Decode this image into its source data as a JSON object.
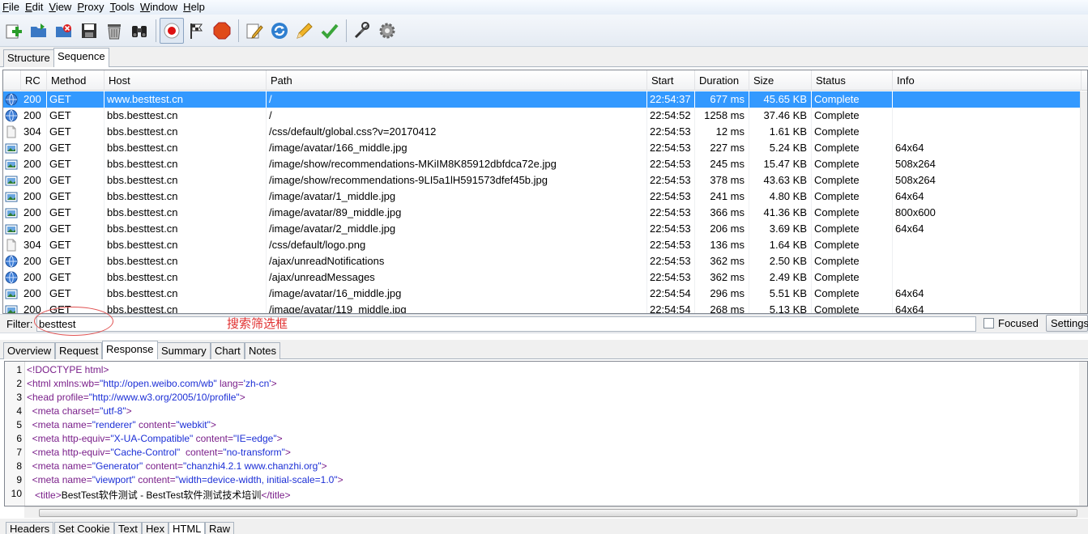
{
  "menu": {
    "items": [
      {
        "label": "File",
        "mnemonic": "F"
      },
      {
        "label": "Edit",
        "mnemonic": "E"
      },
      {
        "label": "View",
        "mnemonic": "V"
      },
      {
        "label": "Proxy",
        "mnemonic": "P"
      },
      {
        "label": "Tools",
        "mnemonic": "T"
      },
      {
        "label": "Window",
        "mnemonic": "W"
      },
      {
        "label": "Help",
        "mnemonic": "H"
      }
    ]
  },
  "toolbar": {
    "buttons": [
      "add-icon",
      "open-icon",
      "close-icon",
      "save-icon",
      "trash-icon",
      "find-binoculars-icon",
      "record-icon",
      "flag-icon",
      "stop-icon",
      "edit-icon",
      "refresh-icon",
      "pencil-icon",
      "checkmark-icon",
      "tools-icon",
      "settings-gear-icon"
    ]
  },
  "view_tabs": {
    "structure": "Structure",
    "sequence": "Sequence",
    "active": "Sequence"
  },
  "table": {
    "columns": {
      "rc": "RC",
      "method": "Method",
      "host": "Host",
      "path": "Path",
      "start": "Start",
      "duration": "Duration",
      "size": "Size",
      "status": "Status",
      "info": "Info"
    },
    "selected_index": 0,
    "rows": [
      {
        "icon": "globe",
        "rc": "200",
        "method": "GET",
        "host": "www.besttest.cn",
        "path": "/",
        "start": "22:54:37",
        "duration": "677 ms",
        "size": "45.65 KB",
        "status": "Complete",
        "info": ""
      },
      {
        "icon": "globe",
        "rc": "200",
        "method": "GET",
        "host": "bbs.besttest.cn",
        "path": "/",
        "start": "22:54:52",
        "duration": "1258 ms",
        "size": "37.46 KB",
        "status": "Complete",
        "info": ""
      },
      {
        "icon": "doc",
        "rc": "304",
        "method": "GET",
        "host": "bbs.besttest.cn",
        "path": "/css/default/global.css?v=20170412",
        "start": "22:54:53",
        "duration": "12 ms",
        "size": "1.61 KB",
        "status": "Complete",
        "info": ""
      },
      {
        "icon": "image",
        "rc": "200",
        "method": "GET",
        "host": "bbs.besttest.cn",
        "path": "/image/avatar/166_middle.jpg",
        "start": "22:54:53",
        "duration": "227 ms",
        "size": "5.24 KB",
        "status": "Complete",
        "info": "64x64"
      },
      {
        "icon": "image",
        "rc": "200",
        "method": "GET",
        "host": "bbs.besttest.cn",
        "path": "/image/show/recommendations-MKiIM8K85912dbfdca72e.jpg",
        "start": "22:54:53",
        "duration": "245 ms",
        "size": "15.47 KB",
        "status": "Complete",
        "info": "508x264"
      },
      {
        "icon": "image",
        "rc": "200",
        "method": "GET",
        "host": "bbs.besttest.cn",
        "path": "/image/show/recommendations-9LI5a1lH591573dfef45b.jpg",
        "start": "22:54:53",
        "duration": "378 ms",
        "size": "43.63 KB",
        "status": "Complete",
        "info": "508x264"
      },
      {
        "icon": "image",
        "rc": "200",
        "method": "GET",
        "host": "bbs.besttest.cn",
        "path": "/image/avatar/1_middle.jpg",
        "start": "22:54:53",
        "duration": "241 ms",
        "size": "4.80 KB",
        "status": "Complete",
        "info": "64x64"
      },
      {
        "icon": "image",
        "rc": "200",
        "method": "GET",
        "host": "bbs.besttest.cn",
        "path": "/image/avatar/89_middle.jpg",
        "start": "22:54:53",
        "duration": "366 ms",
        "size": "41.36 KB",
        "status": "Complete",
        "info": "800x600"
      },
      {
        "icon": "image",
        "rc": "200",
        "method": "GET",
        "host": "bbs.besttest.cn",
        "path": "/image/avatar/2_middle.jpg",
        "start": "22:54:53",
        "duration": "206 ms",
        "size": "3.69 KB",
        "status": "Complete",
        "info": "64x64"
      },
      {
        "icon": "doc",
        "rc": "304",
        "method": "GET",
        "host": "bbs.besttest.cn",
        "path": "/css/default/logo.png",
        "start": "22:54:53",
        "duration": "136 ms",
        "size": "1.64 KB",
        "status": "Complete",
        "info": ""
      },
      {
        "icon": "globe",
        "rc": "200",
        "method": "GET",
        "host": "bbs.besttest.cn",
        "path": "/ajax/unreadNotifications",
        "start": "22:54:53",
        "duration": "362 ms",
        "size": "2.50 KB",
        "status": "Complete",
        "info": ""
      },
      {
        "icon": "globe",
        "rc": "200",
        "method": "GET",
        "host": "bbs.besttest.cn",
        "path": "/ajax/unreadMessages",
        "start": "22:54:53",
        "duration": "362 ms",
        "size": "2.49 KB",
        "status": "Complete",
        "info": ""
      },
      {
        "icon": "image",
        "rc": "200",
        "method": "GET",
        "host": "bbs.besttest.cn",
        "path": "/image/avatar/16_middle.jpg",
        "start": "22:54:54",
        "duration": "296 ms",
        "size": "5.51 KB",
        "status": "Complete",
        "info": "64x64"
      },
      {
        "icon": "image",
        "rc": "200",
        "method": "GET",
        "host": "bbs.besttest.cn",
        "path": "/image/avatar/119_middle.jpg",
        "start": "22:54:54",
        "duration": "268 ms",
        "size": "5.13 KB",
        "status": "Complete",
        "info": "64x64"
      }
    ]
  },
  "filter": {
    "label": "Filter:",
    "value": "besttest",
    "annotation": "搜索筛选框",
    "focused_label": "Focused",
    "focused_checked": false,
    "settings_label": "Settings"
  },
  "detail_tabs": {
    "items": [
      "Overview",
      "Request",
      "Response",
      "Summary",
      "Chart",
      "Notes"
    ],
    "active": "Response"
  },
  "code": {
    "lines": [
      {
        "n": "1",
        "indent": "",
        "parts": [
          [
            "tag",
            "<!DOCTYPE html>"
          ]
        ]
      },
      {
        "n": "2",
        "indent": "",
        "parts": [
          [
            "tag",
            "<html xmlns:wb="
          ],
          [
            "val",
            "\"http://open.weibo.com/wb\""
          ],
          [
            "attr",
            " lang="
          ],
          [
            "val",
            "'zh-cn'"
          ],
          [
            "tag",
            ">"
          ]
        ]
      },
      {
        "n": "3",
        "indent": "",
        "parts": [
          [
            "tag",
            "<head profile="
          ],
          [
            "val",
            "\"http://www.w3.org/2005/10/profile\""
          ],
          [
            "tag",
            ">"
          ]
        ]
      },
      {
        "n": "4",
        "indent": "  ",
        "parts": [
          [
            "tag",
            "<meta charset="
          ],
          [
            "val",
            "\"utf-8\""
          ],
          [
            "tag",
            ">"
          ]
        ]
      },
      {
        "n": "5",
        "indent": "  ",
        "parts": [
          [
            "tag",
            "<meta name="
          ],
          [
            "val",
            "\"renderer\""
          ],
          [
            "attr",
            " content="
          ],
          [
            "val",
            "\"webkit\""
          ],
          [
            "tag",
            ">"
          ]
        ]
      },
      {
        "n": "6",
        "indent": "  ",
        "parts": [
          [
            "tag",
            "<meta http-equiv="
          ],
          [
            "val",
            "\"X-UA-Compatible\""
          ],
          [
            "attr",
            " content="
          ],
          [
            "val",
            "\"IE=edge\""
          ],
          [
            "tag",
            ">"
          ]
        ]
      },
      {
        "n": "7",
        "indent": "  ",
        "parts": [
          [
            "tag",
            "<meta http-equiv="
          ],
          [
            "val",
            "\"Cache-Control\""
          ],
          [
            "attr",
            "  content="
          ],
          [
            "val",
            "\"no-transform\""
          ],
          [
            "tag",
            ">"
          ]
        ]
      },
      {
        "n": "8",
        "indent": "  ",
        "parts": [
          [
            "tag",
            "<meta name="
          ],
          [
            "val",
            "\"Generator\""
          ],
          [
            "attr",
            " content="
          ],
          [
            "val",
            "\"chanzhi4.2.1 www.chanzhi.org\""
          ],
          [
            "tag",
            ">"
          ]
        ]
      },
      {
        "n": "9",
        "indent": "  ",
        "parts": [
          [
            "tag",
            "<meta name="
          ],
          [
            "val",
            "\"viewport\""
          ],
          [
            "attr",
            " content="
          ],
          [
            "val",
            "\"width=device-width, initial-scale=1.0\""
          ],
          [
            "tag",
            ">"
          ]
        ]
      },
      {
        "n": "10",
        "indent": "   ",
        "parts": [
          [
            "tag",
            "<title>"
          ],
          [
            "txt",
            "BestTest软件测试 - BestTest软件测试技术培训"
          ],
          [
            "tag",
            "</title>"
          ]
        ]
      }
    ]
  },
  "format_tabs": {
    "items": [
      "Headers",
      "Set Cookie",
      "Text",
      "Hex",
      "HTML",
      "Raw"
    ],
    "active": "HTML"
  },
  "colors": {
    "selection": "#3399ff",
    "tag": "#7a1f8a",
    "value": "#1c2fd6",
    "annotation": "#e03030"
  }
}
